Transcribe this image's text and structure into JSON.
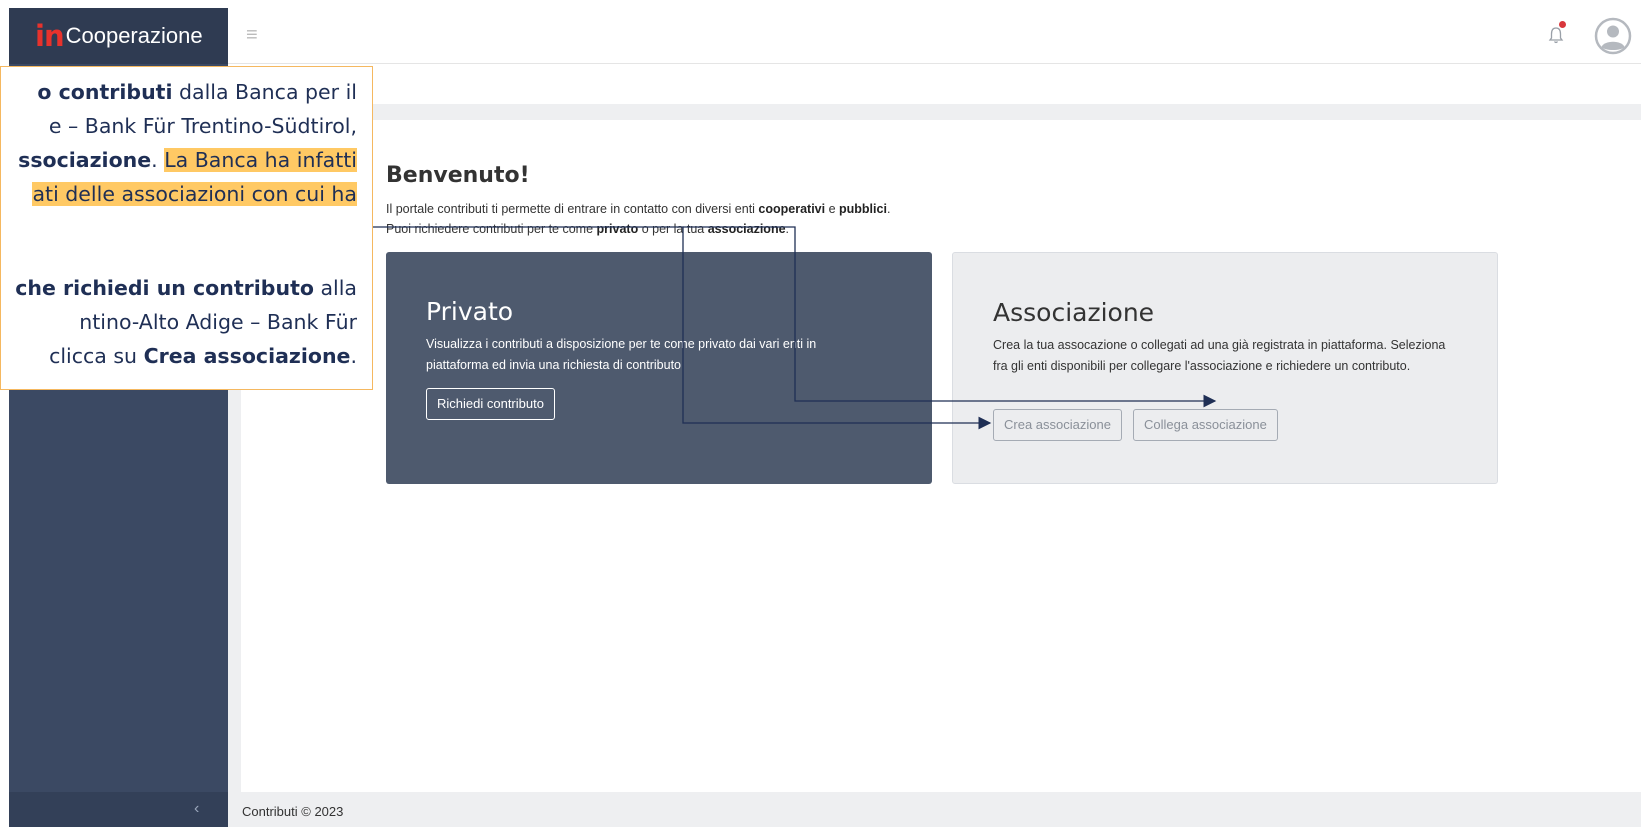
{
  "brand": {
    "prefix": "in",
    "name": "Cooperazione"
  },
  "header": {
    "menu_icon": "hamburger-icon",
    "notification_icon": "bell-icon",
    "user_icon": "user-avatar-icon"
  },
  "welcome": {
    "title": "Benvenuto!",
    "line1_a": "Il portale contributi ti permette di entrare in contatto con diversi enti ",
    "line1_b": "cooperativi",
    "line1_c": " e ",
    "line1_d": "pubblici",
    "line1_e": ".",
    "line2_a": "Puoi richiedere contributi per te come ",
    "line2_b": "privato",
    "line2_c": " o per la tua ",
    "line2_d": "associazione",
    "line2_e": "."
  },
  "private_card": {
    "title": "Privato",
    "description": "Visualizza i contributi a disposizione per te come privato dai vari enti in piattaforma ed invia una richiesta di contributo",
    "button": "Richiedi contributo"
  },
  "association_card": {
    "title": "Associazione",
    "description": "Crea la tua assocazione o collegati ad una già registrata in piattaforma. Seleziona fra gli enti disponibili per collegare l'associazione e richiedere un contributo.",
    "create_button": "Crea associazione",
    "link_button": "Collega associazione"
  },
  "footer": {
    "text": "Contributi © 2023"
  },
  "sidebar": {
    "collapse_icon": "chevron-left-icon"
  },
  "callout": {
    "p1": [
      {
        "a": "o contributi",
        "b": " dalla Banca per il"
      },
      {
        "a": "e – Bank Für Trentino-Südtirol,",
        "b": ""
      },
      {
        "a": "ssociazione",
        "b": ". ",
        "c": "La Banca ha infatti"
      },
      {
        "a": "ati delle associazioni con cui ha",
        "b": ""
      }
    ],
    "p2": [
      {
        "a": " che richiedi un contributo",
        "b": " alla"
      },
      {
        "a": "ntino-Alto Adige – Bank Für",
        "b": ""
      },
      {
        "a": "clicca su ",
        "b": "Crea associazione",
        "c": "."
      }
    ]
  },
  "colors": {
    "sidebar": "#3b4963",
    "brand_red": "#e8322c",
    "callout_border": "#f5b860",
    "highlight": "#ffc964",
    "arrow": "#1f2f55"
  }
}
